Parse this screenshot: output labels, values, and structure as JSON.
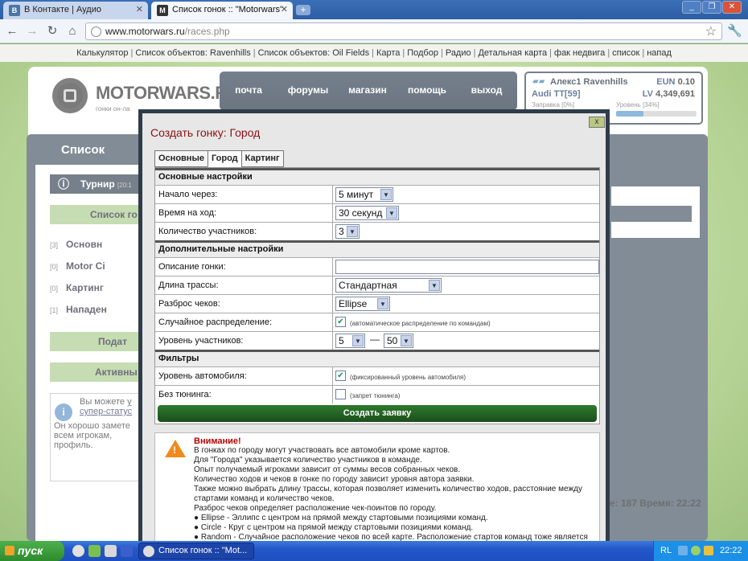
{
  "browser": {
    "tabs": [
      {
        "label": "В Контакте | Аудио",
        "favicon": "В"
      },
      {
        "label": "Список гонок :: \"Motorwars\"",
        "favicon": "M"
      }
    ],
    "new_tab": "+",
    "window_buttons": [
      "_",
      "❐",
      "✕"
    ],
    "url_host": "www.motorwars.ru",
    "url_path": "/races.php",
    "nav": [
      "←",
      "→",
      "↻",
      "⌂"
    ]
  },
  "site_nav": [
    "Калькулятор",
    "Список объектов: Ravenhills",
    "Список объектов: Oil Fields",
    "Карта",
    "Подбор",
    "Радио",
    "Детальная карта",
    "фак недвига",
    "список",
    "напад"
  ],
  "logo": {
    "text": "MOTORWARS.RU",
    "sub": "гонки он-ла"
  },
  "menu": [
    "почта",
    "форумы",
    "магазин",
    "помощь",
    "выход"
  ],
  "profile": {
    "name": "Алекс1 Ravenhills",
    "car": "Audi TT[59]",
    "currency_label": "EUN",
    "currency_value": "0.10",
    "lv_label": "LV",
    "lv_value": "4,349,691",
    "refuel_label": "Заправка",
    "refuel_pct": "[0%]",
    "level_label": "Уровень",
    "level_pct": "[34%]",
    "level_progress": 34
  },
  "left_panel": {
    "title": "Список",
    "turnir": "Турнир",
    "turnir_time": "[20:1",
    "list_label": "Список го",
    "rows": [
      {
        "count": "[3]",
        "label": "Основн"
      },
      {
        "count": "[0]",
        "label": "Motor Ci"
      },
      {
        "count": "[0]",
        "label": "Картинг"
      },
      {
        "count": "[1]",
        "label": "Нападен"
      }
    ],
    "give_label": "Подат",
    "active_label": "Активны",
    "info_line1": "Вы можете",
    "info_link1": "у",
    "info_line2": "супер-статус",
    "info_text": "Он хорошо замете всем игрокам, профиль."
  },
  "status_bar": {
    "text": "е: 187  Время: 22:22"
  },
  "dialog": {
    "title": "Создать гонку: Город",
    "close": "x",
    "tabs": [
      "Основные",
      "Город",
      "Картинг"
    ],
    "active_tab": 1,
    "section_basic": "Основные настройки",
    "start_label": "Начало через:",
    "start_value": "5 минут",
    "turn_label": "Время на ход:",
    "turn_value": "30 секунд",
    "count_label": "Количество участников:",
    "count_value": "3",
    "section_extra": "Дополнительные настройки",
    "desc_label": "Описание гонки:",
    "length_label": "Длина трассы:",
    "length_value": "Стандартная",
    "spread_label": "Разброс чеков:",
    "spread_value": "Ellipse",
    "random_label": "Случайное распределение:",
    "random_hint": "(автоматическое распределение по командам)",
    "level_label": "Уровень участников:",
    "level_from": "5",
    "level_dash": "—",
    "level_to": "50",
    "section_filters": "Фильтры",
    "carlevel_label": "Уровень автомобиля:",
    "carlevel_hint": "(фиксированный уровень автомобиля)",
    "notuning_label": "Без тюнинга:",
    "notuning_hint": "(запрет тюнинга)",
    "submit": "Создать заявку",
    "warning_title": "Внимание!",
    "warning_lines": [
      "В гонках по городу могут участвовать все автомобили кроме картов.",
      "Для \"Города\" указывается количество участников в команде.",
      "Опыт получаемый игроками зависит от суммы весов собранных чеков.",
      "Количество ходов и чеков в гонке по городу зависит уровня автора заявки.",
      "Также можно выбрать длину трассы, которая позволяет изменить количество ходов, расстояние между стартами команд и количество чеков.",
      "Разброс чеков определяет расположение чек-поинтов по городу.",
      "● Ellipse - Эллипс с центром на прямой между стартовыми позициями команд.",
      "● Circle - Круг с центром на прямой между стартовыми позициями команд.",
      "● Random - Случайное расположение чеков по всей карте. Расположение стартов команд тоже является"
    ]
  },
  "taskbar": {
    "start": "пуск",
    "task": "Список гонок :: \"Mot...",
    "lang": "RL",
    "clock": "22:22"
  }
}
